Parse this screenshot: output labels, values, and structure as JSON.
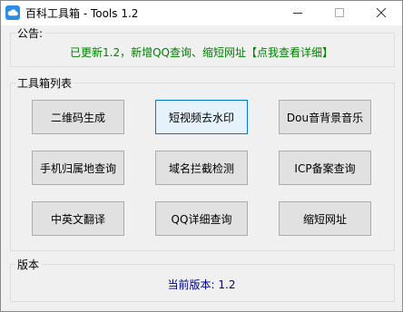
{
  "window": {
    "title": "百科工具箱 - Tools 1.2",
    "icon": "cloud-icon"
  },
  "notice": {
    "label": "公告:",
    "text": "已更新1.2，新增QQ查询、缩短网址【点我查看详细】",
    "color": "#008000"
  },
  "toolbox": {
    "label": "工具箱列表",
    "buttons": [
      {
        "label": "二维码生成"
      },
      {
        "label": "短视频去水印"
      },
      {
        "label": "Dou音背景音乐"
      },
      {
        "label": "手机归属地查询"
      },
      {
        "label": "域名拦截检测"
      },
      {
        "label": "ICP备案查询"
      },
      {
        "label": "中英文翻译"
      },
      {
        "label": "QQ详细查询"
      },
      {
        "label": "缩短网址"
      }
    ]
  },
  "version": {
    "label": "版本",
    "text": "当前版本: 1.2",
    "color": "#000080"
  }
}
